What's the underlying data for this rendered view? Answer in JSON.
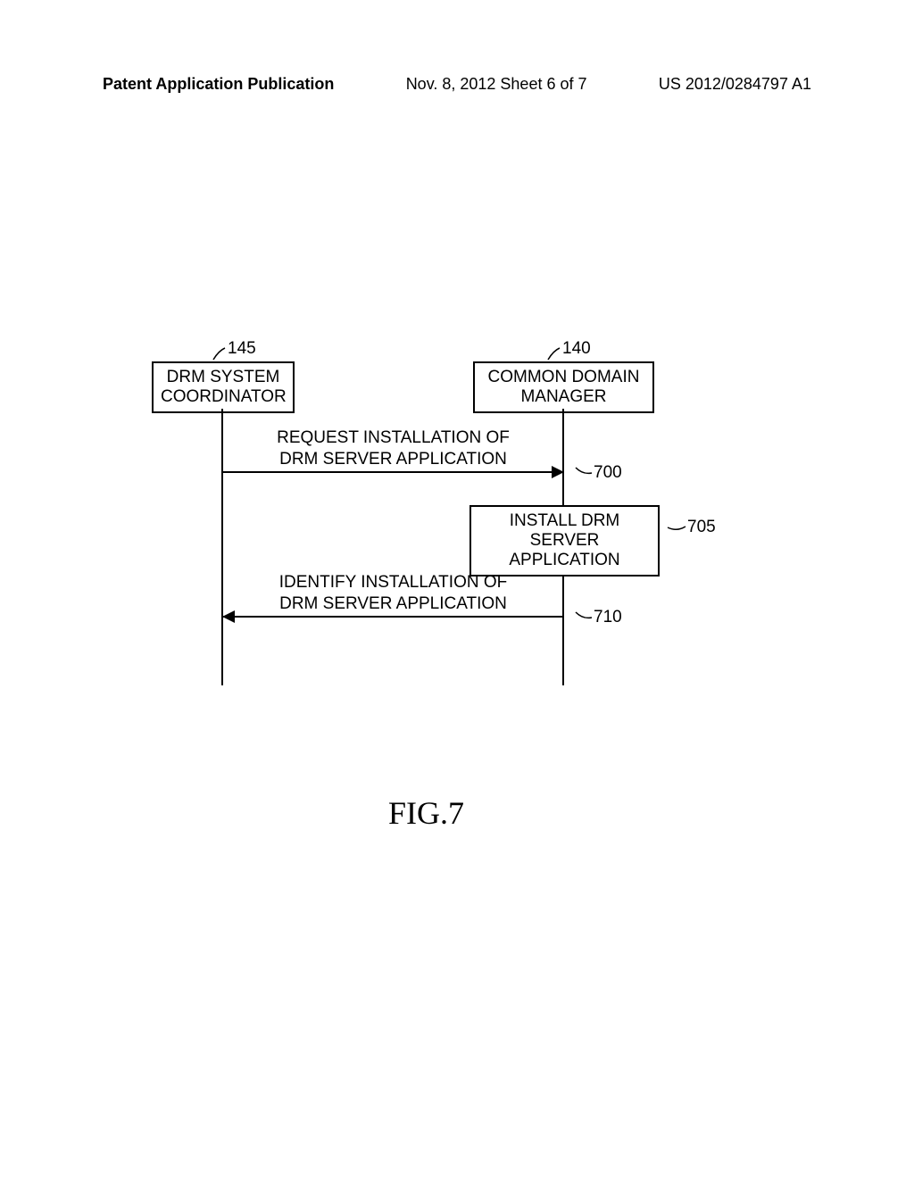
{
  "header": {
    "left": "Patent Application Publication",
    "center": "Nov. 8, 2012  Sheet 6 of 7",
    "right": "US 2012/0284797 A1"
  },
  "diagram": {
    "entity_left": {
      "label_line1": "DRM SYSTEM",
      "label_line2": "COORDINATOR",
      "ref": "145"
    },
    "entity_right": {
      "label_line1": "COMMON DOMAIN",
      "label_line2": "MANAGER",
      "ref": "140"
    },
    "steps": {
      "s700": {
        "text_line1": "REQUEST INSTALLATION OF",
        "text_line2": "DRM SERVER APPLICATION",
        "ref": "700"
      },
      "s705": {
        "text_line1": "INSTALL DRM SERVER",
        "text_line2": "APPLICATION",
        "ref": "705"
      },
      "s710": {
        "text_line1": "IDENTIFY INSTALLATION OF",
        "text_line2": "DRM SERVER APPLICATION",
        "ref": "710"
      }
    },
    "figure_label": "FIG.7"
  }
}
